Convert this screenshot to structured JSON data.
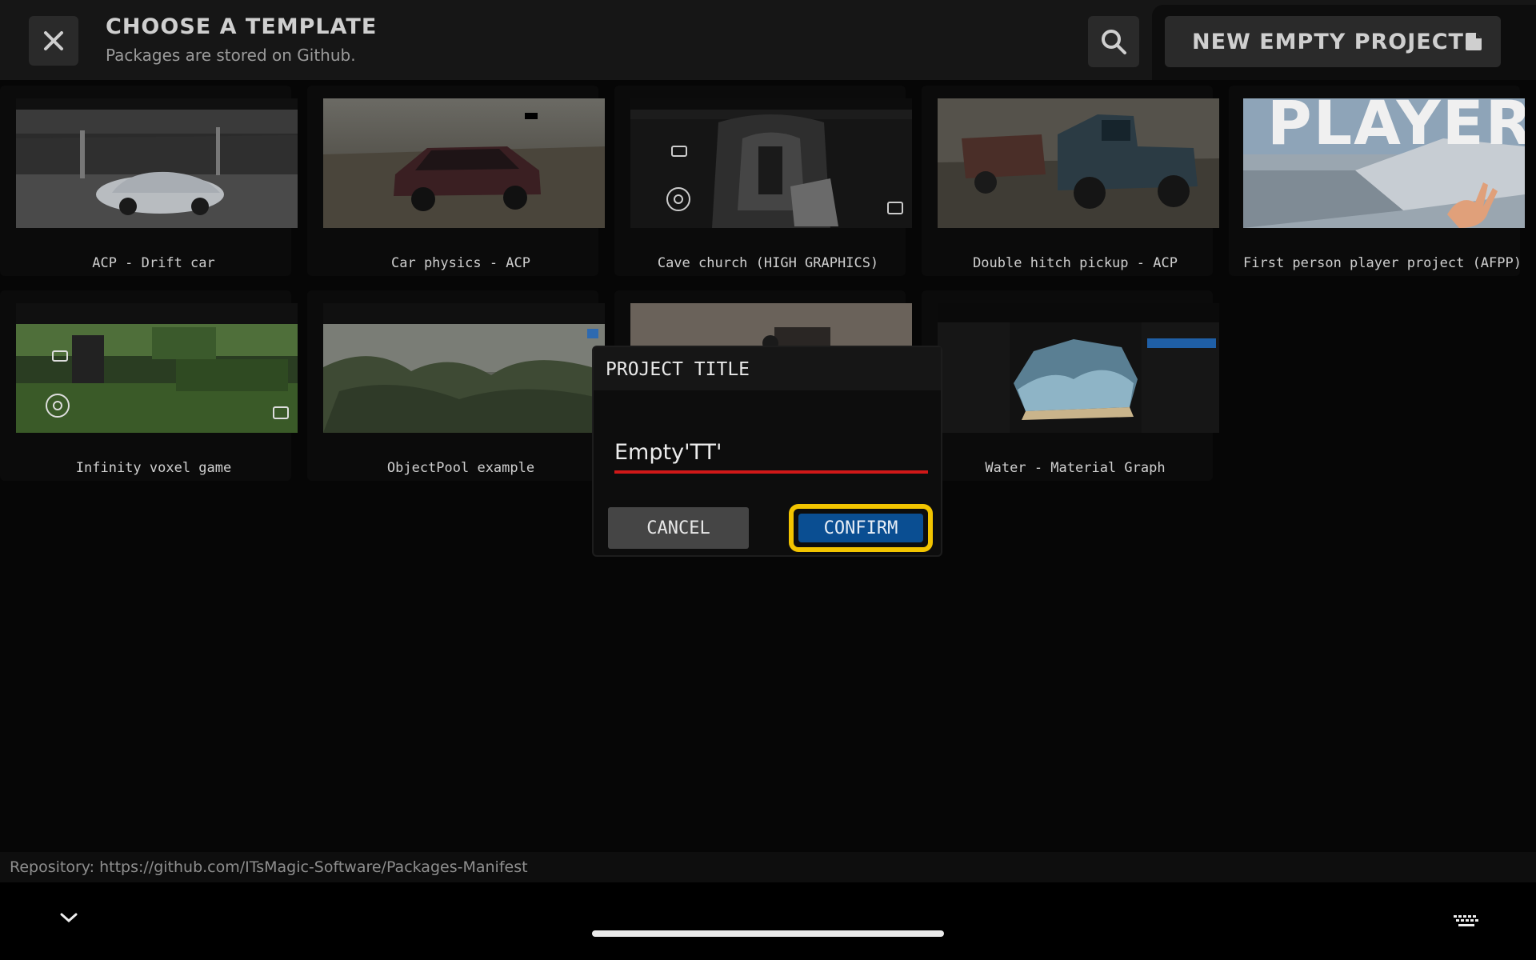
{
  "header": {
    "title": "CHOOSE A TEMPLATE",
    "subtitle": "Packages are stored on Github.",
    "close_icon": "close-icon",
    "search_icon": "search-icon",
    "new_project_label": "NEW EMPTY PROJECT",
    "new_project_icon": "new-file-icon"
  },
  "templates": [
    {
      "label": "ACP - Drift car"
    },
    {
      "label": "Car physics - ACP"
    },
    {
      "label": "Cave church (HIGH GRAPHICS)"
    },
    {
      "label": "Double hitch pickup - ACP"
    },
    {
      "label": "First person player project (AFPP)",
      "thumb_text": "PLAYER"
    },
    {
      "label": "Infinity voxel game"
    },
    {
      "label": "ObjectPool example"
    },
    {
      "label": ""
    },
    {
      "label": "Water - Material Graph"
    }
  ],
  "dialog": {
    "title": "PROJECT TITLE",
    "input_value": "Empty'TT'",
    "cancel_label": "CANCEL",
    "confirm_label": "CONFIRM",
    "accent_color": "#d01818",
    "highlight_color": "#f2c400",
    "confirm_color": "#0a4e92"
  },
  "footer": {
    "repository_text": "Repository: https://github.com/ITsMagic-Software/Packages-Manifest",
    "chevron_icon": "chevron-down-icon",
    "keyboard_icon": "keyboard-icon"
  }
}
